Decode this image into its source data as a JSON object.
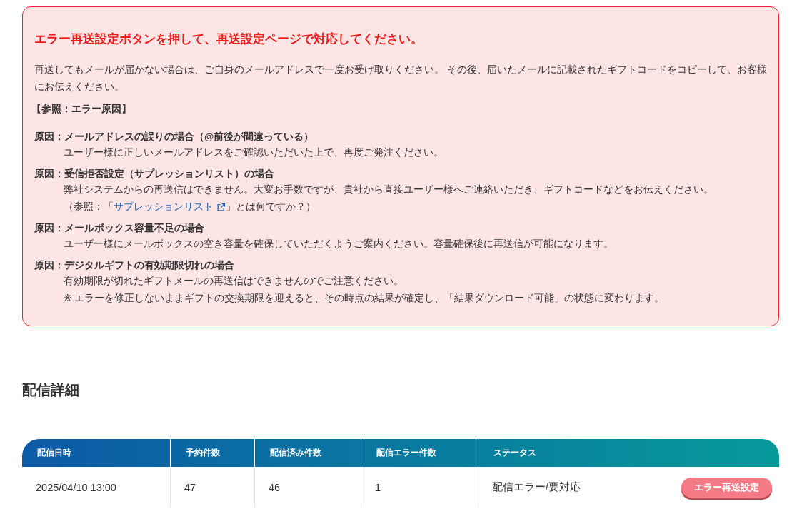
{
  "alert": {
    "title": "エラー再送設定ボタンを押して、再送設定ページで対応してください。",
    "intro": "再送してもメールが届かない場合は、ご自身のメールアドレスで一度お受け取りください。 その後、届いたメールに記載されたギフトコードをコピーして、お客様にお伝えください。",
    "reference_heading": "【参照：エラー原因】",
    "causes": [
      {
        "label": "原因：",
        "title": "メールアドレスの誤りの場合（@前後が間違っている）",
        "lines": [
          {
            "kind": "text",
            "text": "ユーザー様に正しいメールアドレスをご確認いただいた上で、再度ご発注ください。"
          }
        ]
      },
      {
        "label": "原因：",
        "title": "受信拒否設定（サプレッションリスト）の場合",
        "lines": [
          {
            "kind": "text",
            "text": "弊社システムからの再送信はできません。大変お手数ですが、貴社から直接ユーザー様へご連絡いただき、ギフトコードなどをお伝えください。"
          },
          {
            "kind": "link",
            "prefix": "（参照：「",
            "link": "サプレッションリスト",
            "suffix": "」とは何ですか？）"
          }
        ]
      },
      {
        "label": "原因：",
        "title": "メールボックス容量不足の場合",
        "lines": [
          {
            "kind": "text",
            "text": "ユーザー様にメールボックスの空き容量を確保していただくようご案内ください。容量確保後に再送信が可能になります。"
          }
        ]
      },
      {
        "label": "原因：",
        "title": "デジタルギフトの有効期限切れの場合",
        "lines": [
          {
            "kind": "text",
            "text": "有効期限が切れたギフトメールの再送信はできませんのでご注意ください。"
          },
          {
            "kind": "text",
            "text": "※ エラーを修正しないままギフトの交換期限を迎えると、その時点の結果が確定し、「結果ダウンロード可能」の状態に変わります。"
          }
        ]
      }
    ]
  },
  "section_title": "配信詳細",
  "table": {
    "columns": [
      "配信日時",
      "予約件数",
      "配信済み件数",
      "配信エラー件数",
      "ステータス"
    ],
    "rows": [
      {
        "cells": [
          "2025/04/10 13:00",
          "47",
          "46",
          "1",
          "配信エラー/要対応"
        ],
        "action": "エラー再送設定"
      }
    ]
  }
}
